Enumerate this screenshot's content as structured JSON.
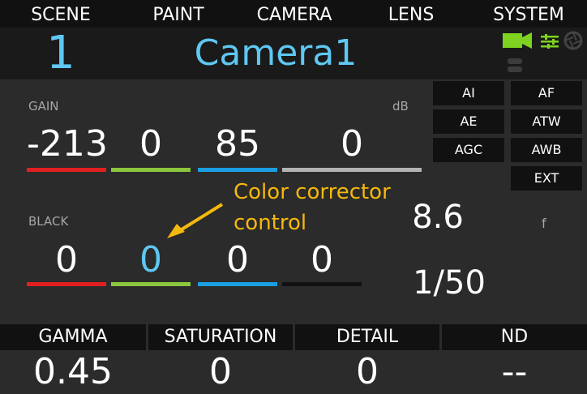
{
  "nav": {
    "tabs": [
      "SCENE",
      "PAINT",
      "CAMERA",
      "LENS",
      "SYSTEM"
    ]
  },
  "header": {
    "scene_number": "1",
    "camera_name": "Camera1",
    "icons": [
      "video-camera-icon",
      "sliders-icon",
      "aperture-icon",
      "storage-icon"
    ]
  },
  "gain": {
    "label": "GAIN",
    "unit": "dB",
    "values": [
      "-213",
      "0",
      "85",
      "0"
    ],
    "bar_colors": [
      "#e02020",
      "#8cc63e",
      "#1a9ee0",
      "#b3b3b3"
    ]
  },
  "black": {
    "label": "BLACK",
    "values": [
      "0",
      "0",
      "0",
      "0"
    ],
    "bar_colors": [
      "#e02020",
      "#8cc63e",
      "#1a9ee0",
      "#111111"
    ],
    "highlight_color": "#5ec8f2"
  },
  "auto_buttons": {
    "col1": [
      "AI",
      "AE",
      "AGC"
    ],
    "col2": [
      "AF",
      "ATW",
      "AWB",
      "EXT"
    ]
  },
  "lens": {
    "iris_value": "8.6",
    "iris_unit": "f",
    "shutter": "1/50"
  },
  "annotation": {
    "line1": "Color corrector",
    "line2": "control",
    "color": "#f5b80c"
  },
  "bottom": {
    "headers": [
      "GAMMA",
      "SATURATION",
      "DETAIL",
      "ND"
    ],
    "values": [
      "0.45",
      "0",
      "0",
      "--"
    ]
  },
  "colors": {
    "accent": "#5ec8f2",
    "green_icon": "#7ed321",
    "background": "#2b2b2b",
    "panel_dark": "#111111"
  }
}
